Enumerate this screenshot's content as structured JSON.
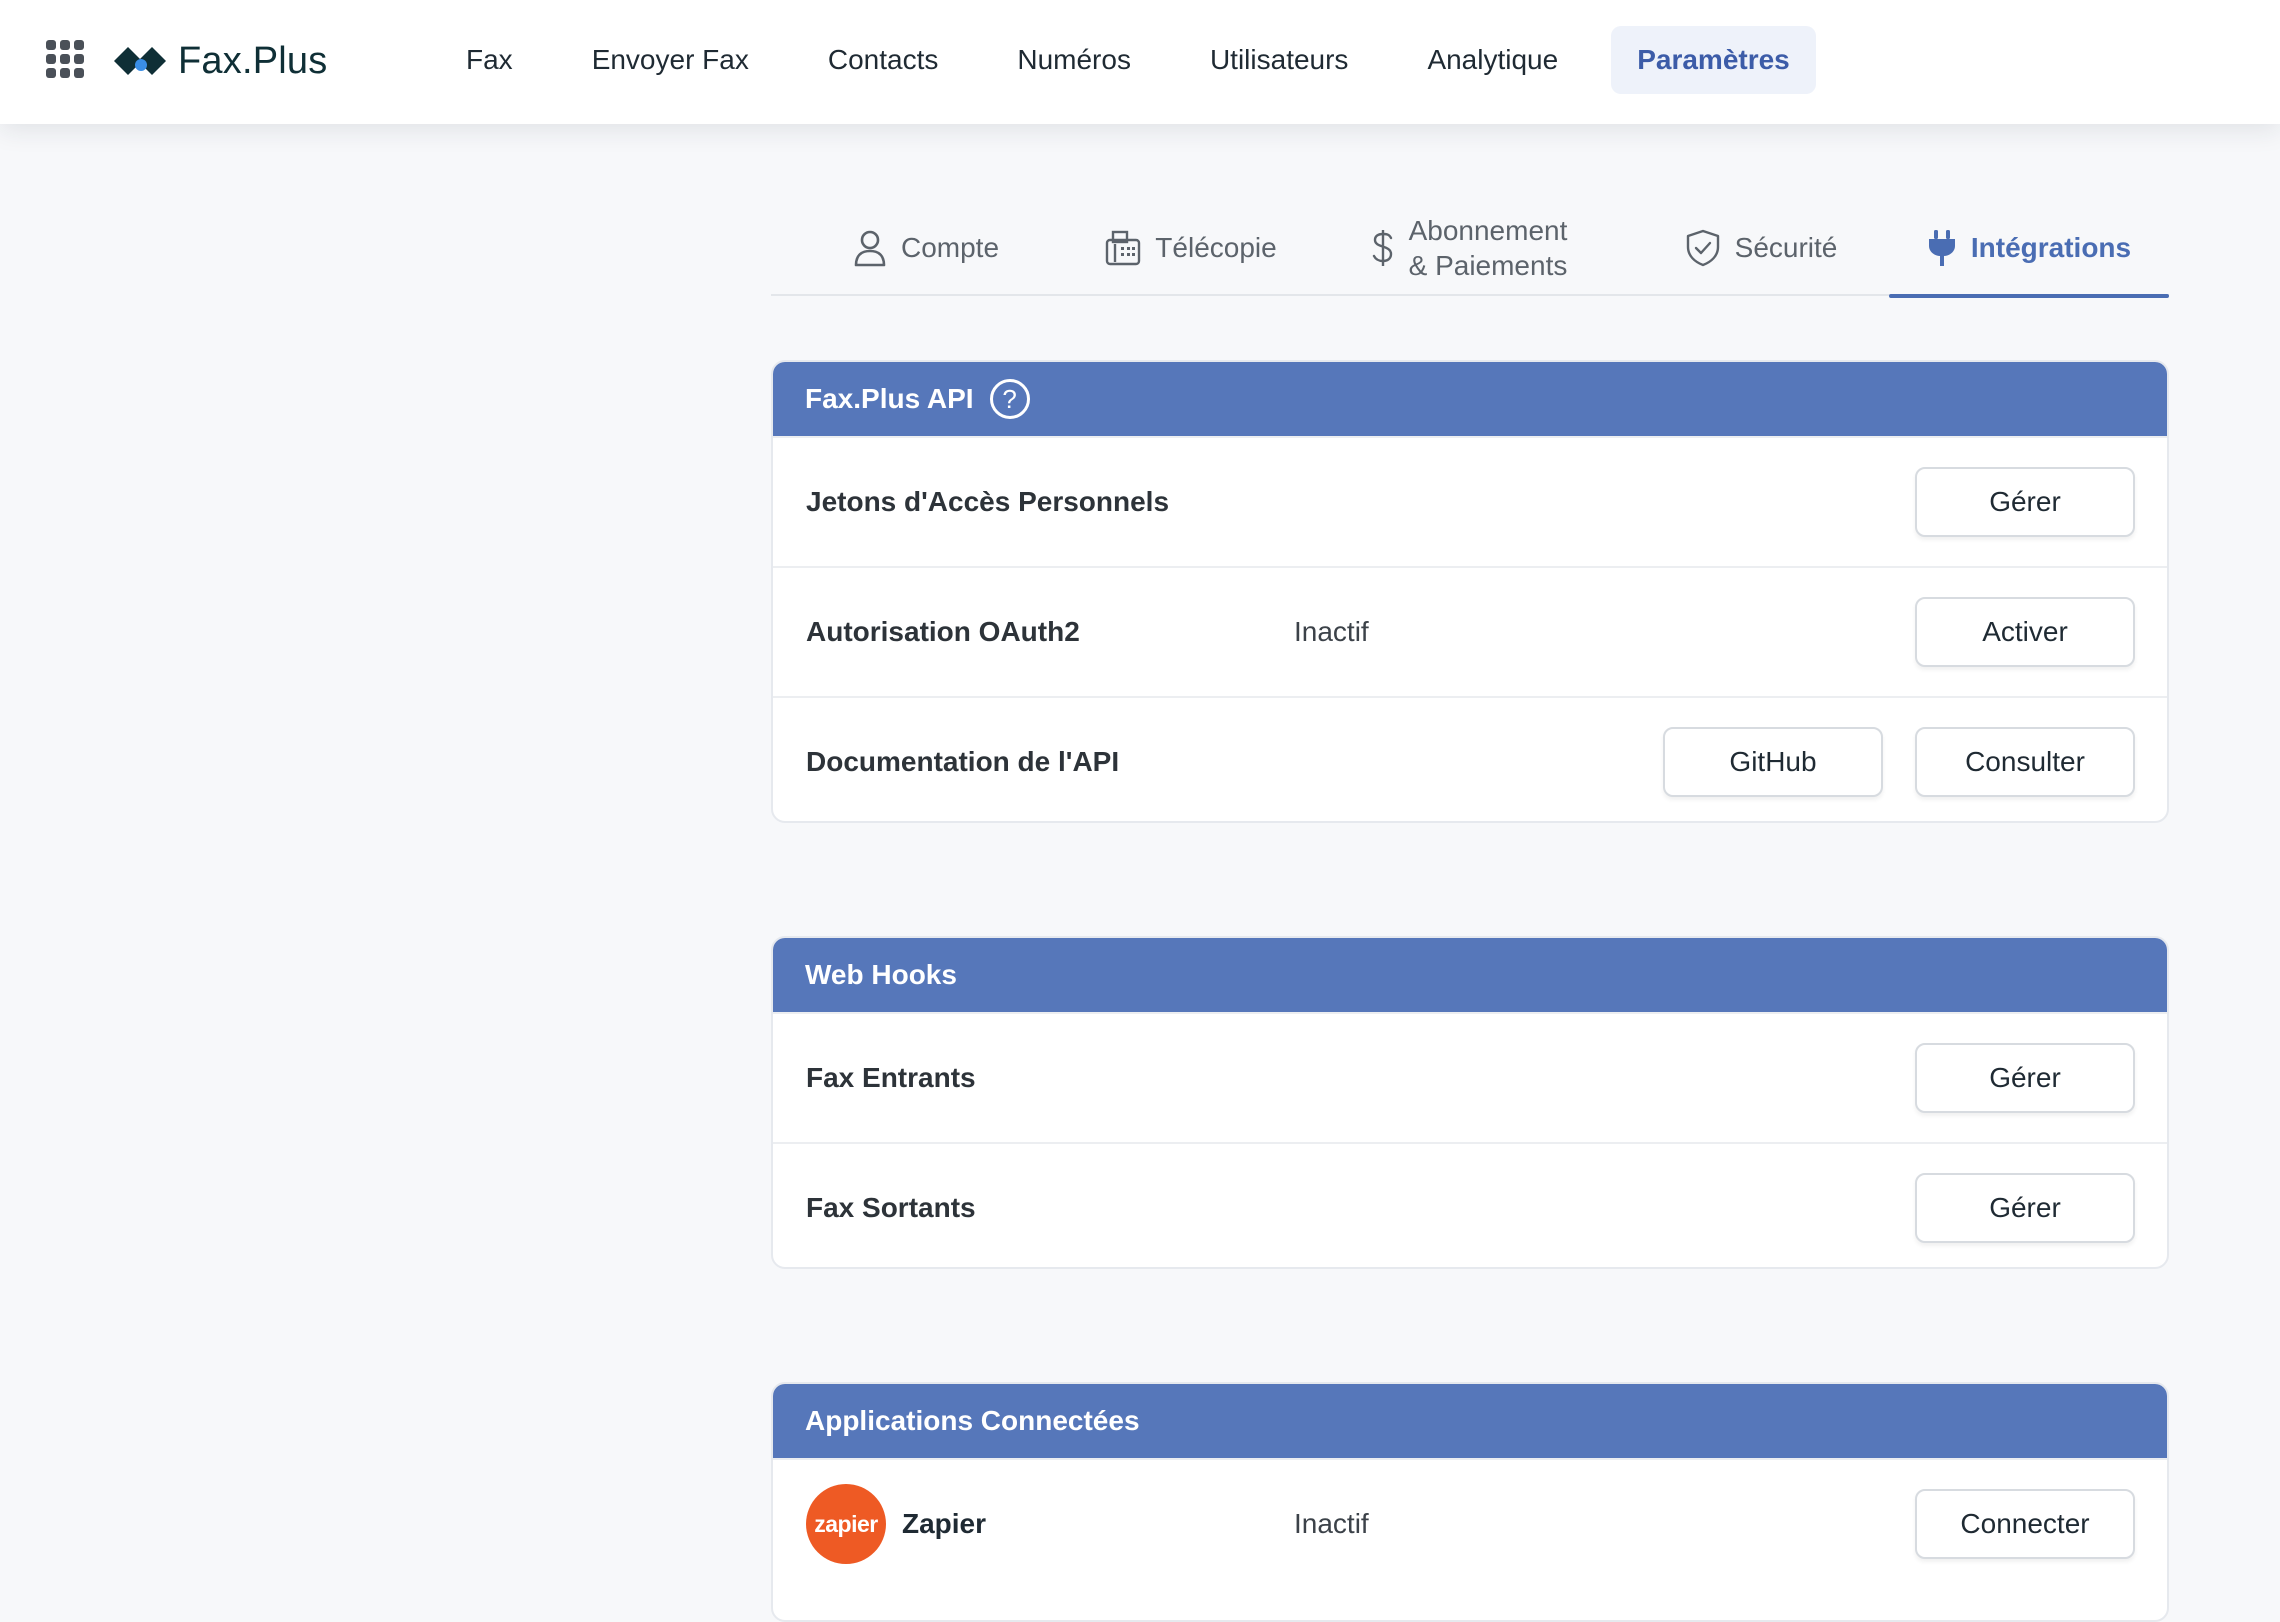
{
  "brand": {
    "name": "Fax.Plus"
  },
  "nav": {
    "items": [
      {
        "label": "Fax"
      },
      {
        "label": "Envoyer Fax"
      },
      {
        "label": "Contacts"
      },
      {
        "label": "Numéros"
      },
      {
        "label": "Utilisateurs"
      },
      {
        "label": "Analytique"
      },
      {
        "label": "Paramètres",
        "active": true
      }
    ]
  },
  "subtabs": {
    "items": [
      {
        "label": "Compte",
        "icon": "user-icon"
      },
      {
        "label": "Télécopie",
        "icon": "fax-machine-icon"
      },
      {
        "label_line1": "Abonnement",
        "label_line2": "& Paiements",
        "icon": "dollar-icon"
      },
      {
        "label": "Sécurité",
        "icon": "shield-check-icon"
      },
      {
        "label": "Intégrations",
        "icon": "plug-icon",
        "active": true
      }
    ]
  },
  "api_card": {
    "title": "Fax.Plus API",
    "help_symbol": "?",
    "rows": [
      {
        "label": "Jetons d'Accès Personnels",
        "button": "Gérer"
      },
      {
        "label": "Autorisation OAuth2",
        "status": "Inactif",
        "button": "Activer"
      },
      {
        "label": "Documentation de l'API",
        "button_secondary": "GitHub",
        "button": "Consulter"
      }
    ]
  },
  "webhooks_card": {
    "title": "Web Hooks",
    "rows": [
      {
        "label": "Fax Entrants",
        "button": "Gérer"
      },
      {
        "label": "Fax Sortants",
        "button": "Gérer"
      }
    ]
  },
  "apps_card": {
    "title": "Applications Connectées",
    "rows": [
      {
        "label": "Zapier",
        "logo_text": "zapier",
        "status": "Inactif",
        "button": "Connecter"
      }
    ]
  },
  "colors": {
    "header_blue": "#5677ba",
    "accent": "#4a6db3",
    "zapier_orange": "#ee5a24"
  }
}
